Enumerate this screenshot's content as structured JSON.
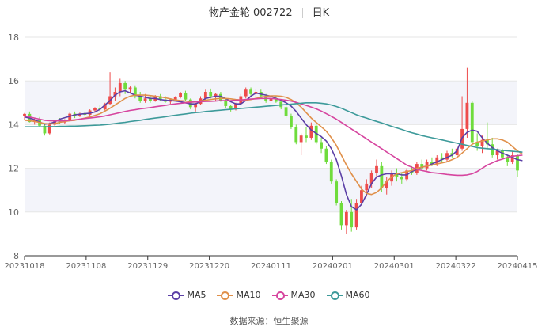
{
  "header": {
    "stock": "物产金轮 002722",
    "period": "日K"
  },
  "source": "数据来源：恒生聚源",
  "colors": {
    "up": "#ee4b4b",
    "down": "#6fdc3c",
    "band": "#f3f4fa",
    "grid": "#e6e6e6",
    "axis": "#666666"
  },
  "chart_data": {
    "type": "candlestick",
    "title": "物产金轮 002722",
    "ylim": [
      8,
      18
    ],
    "yticks": [
      8,
      10,
      12,
      14,
      16,
      18
    ],
    "xtick_labels": [
      "20231018",
      "20231108",
      "20231129",
      "20231220",
      "20240111",
      "20240201",
      "20240301",
      "20240322",
      "20240415"
    ],
    "legend_position": "bottom-center",
    "legend": [
      {
        "name": "MA5",
        "color": "#5b3fa6"
      },
      {
        "name": "MA10",
        "color": "#e0904a"
      },
      {
        "name": "MA30",
        "color": "#d6459f"
      },
      {
        "name": "MA60",
        "color": "#3d9a9a"
      }
    ],
    "ohlc": [
      [
        14.39,
        14.53,
        14.2,
        14.49
      ],
      [
        14.49,
        14.6,
        14.1,
        14.12
      ],
      [
        14.12,
        14.3,
        14.0,
        14.2
      ],
      [
        14.2,
        14.35,
        13.9,
        13.95
      ],
      [
        13.95,
        14.05,
        13.5,
        13.6
      ],
      [
        13.6,
        14.1,
        13.55,
        14.0
      ],
      [
        14.0,
        14.2,
        13.95,
        14.15
      ],
      [
        14.15,
        14.3,
        14.05,
        14.1
      ],
      [
        14.1,
        14.25,
        14.05,
        14.2
      ],
      [
        14.2,
        14.55,
        14.15,
        14.5
      ],
      [
        14.5,
        14.6,
        14.3,
        14.4
      ],
      [
        14.4,
        14.55,
        14.35,
        14.5
      ],
      [
        14.5,
        14.6,
        14.4,
        14.45
      ],
      [
        14.45,
        14.7,
        14.4,
        14.65
      ],
      [
        14.65,
        14.8,
        14.55,
        14.75
      ],
      [
        14.75,
        14.9,
        14.6,
        14.7
      ],
      [
        14.7,
        15.0,
        14.65,
        14.95
      ],
      [
        14.95,
        16.4,
        14.9,
        15.3
      ],
      [
        15.3,
        15.7,
        15.1,
        15.5
      ],
      [
        15.5,
        16.1,
        15.3,
        15.9
      ],
      [
        15.9,
        16.0,
        15.4,
        15.6
      ],
      [
        15.6,
        15.75,
        15.45,
        15.7
      ],
      [
        15.7,
        15.8,
        15.2,
        15.3
      ],
      [
        15.3,
        15.5,
        15.0,
        15.1
      ],
      [
        15.1,
        15.4,
        15.0,
        15.2
      ],
      [
        15.2,
        15.3,
        15.0,
        15.1
      ],
      [
        15.1,
        15.35,
        15.05,
        15.3
      ],
      [
        15.3,
        15.4,
        15.1,
        15.15
      ],
      [
        15.15,
        15.3,
        15.0,
        15.05
      ],
      [
        15.05,
        15.2,
        14.95,
        15.15
      ],
      [
        15.15,
        15.3,
        15.1,
        15.25
      ],
      [
        15.25,
        15.5,
        15.2,
        15.45
      ],
      [
        15.45,
        15.55,
        15.1,
        15.15
      ],
      [
        15.15,
        15.2,
        14.7,
        14.8
      ],
      [
        14.8,
        15.0,
        14.6,
        14.95
      ],
      [
        14.95,
        15.3,
        14.9,
        15.2
      ],
      [
        15.2,
        15.6,
        15.1,
        15.5
      ],
      [
        15.5,
        15.65,
        15.2,
        15.3
      ],
      [
        15.3,
        15.45,
        15.1,
        15.4
      ],
      [
        15.4,
        15.5,
        15.05,
        15.1
      ],
      [
        15.1,
        15.2,
        14.75,
        14.85
      ],
      [
        14.85,
        14.9,
        14.6,
        14.7
      ],
      [
        14.7,
        15.0,
        14.65,
        14.95
      ],
      [
        14.95,
        15.4,
        14.9,
        15.3
      ],
      [
        15.3,
        15.7,
        15.2,
        15.6
      ],
      [
        15.6,
        15.7,
        15.3,
        15.4
      ],
      [
        15.4,
        15.6,
        15.2,
        15.5
      ],
      [
        15.5,
        15.6,
        15.2,
        15.3
      ],
      [
        15.3,
        15.4,
        15.0,
        15.1
      ],
      [
        15.1,
        15.25,
        14.9,
        15.2
      ],
      [
        15.2,
        15.3,
        15.0,
        15.05
      ],
      [
        15.05,
        15.15,
        14.7,
        14.8
      ],
      [
        14.8,
        14.9,
        14.3,
        14.4
      ],
      [
        14.4,
        14.5,
        13.8,
        13.9
      ],
      [
        13.9,
        14.0,
        13.1,
        13.2
      ],
      [
        13.2,
        13.6,
        12.6,
        13.5
      ],
      [
        13.5,
        13.9,
        13.2,
        13.4
      ],
      [
        13.4,
        14.1,
        13.3,
        13.95
      ],
      [
        13.95,
        14.0,
        13.1,
        13.2
      ],
      [
        13.2,
        13.4,
        12.7,
        12.9
      ],
      [
        12.9,
        13.0,
        12.2,
        12.3
      ],
      [
        12.3,
        12.4,
        11.3,
        11.4
      ],
      [
        11.4,
        11.5,
        10.3,
        10.4
      ],
      [
        10.4,
        10.5,
        9.2,
        9.4
      ],
      [
        9.4,
        10.1,
        9.0,
        10.0
      ],
      [
        10.0,
        10.6,
        9.1,
        9.3
      ],
      [
        9.3,
        10.6,
        9.2,
        10.4
      ],
      [
        10.4,
        11.2,
        10.3,
        11.0
      ],
      [
        11.0,
        11.5,
        10.7,
        11.3
      ],
      [
        11.3,
        11.9,
        11.1,
        11.8
      ],
      [
        11.8,
        12.4,
        11.6,
        12.1
      ],
      [
        12.1,
        12.3,
        10.9,
        11.1
      ],
      [
        11.1,
        11.6,
        10.8,
        11.4
      ],
      [
        11.4,
        11.9,
        11.2,
        11.8
      ],
      [
        11.8,
        12.0,
        11.4,
        11.6
      ],
      [
        11.6,
        11.8,
        11.3,
        11.5
      ],
      [
        11.5,
        12.0,
        11.4,
        11.9
      ],
      [
        11.9,
        12.1,
        11.7,
        11.8
      ],
      [
        11.8,
        12.3,
        11.7,
        12.2
      ],
      [
        12.2,
        12.4,
        11.9,
        12.0
      ],
      [
        12.0,
        12.4,
        11.9,
        12.3
      ],
      [
        12.3,
        12.5,
        12.1,
        12.2
      ],
      [
        12.2,
        12.6,
        12.1,
        12.5
      ],
      [
        12.5,
        12.7,
        12.3,
        12.4
      ],
      [
        12.4,
        12.8,
        12.3,
        12.7
      ],
      [
        12.7,
        12.9,
        12.5,
        12.6
      ],
      [
        12.6,
        13.0,
        12.5,
        12.9
      ],
      [
        12.9,
        15.3,
        12.8,
        13.8
      ],
      [
        13.8,
        16.6,
        13.4,
        15.0
      ],
      [
        15.0,
        15.1,
        13.0,
        13.2
      ],
      [
        13.2,
        13.6,
        12.8,
        13.0
      ],
      [
        13.0,
        13.5,
        12.7,
        13.3
      ],
      [
        13.3,
        14.1,
        12.9,
        13.1
      ],
      [
        13.1,
        13.4,
        12.5,
        12.6
      ],
      [
        12.6,
        12.9,
        12.4,
        12.8
      ],
      [
        12.8,
        12.9,
        12.4,
        12.5
      ],
      [
        12.5,
        12.6,
        12.1,
        12.3
      ],
      [
        12.3,
        12.8,
        12.2,
        12.6
      ],
      [
        12.6,
        12.65,
        11.6,
        11.9
      ]
    ],
    "ma5": [
      14.35,
      14.3,
      14.22,
      14.12,
      14.02,
      14.05,
      14.12,
      14.25,
      14.32,
      14.38,
      14.45,
      14.48,
      14.5,
      14.52,
      14.58,
      14.7,
      14.9,
      15.1,
      15.35,
      15.5,
      15.55,
      15.45,
      15.35,
      15.3,
      15.25,
      15.2,
      15.2,
      15.15,
      15.12,
      15.1,
      15.08,
      15.05,
      15.0,
      14.95,
      14.95,
      15.05,
      15.2,
      15.25,
      15.3,
      15.3,
      15.2,
      15.05,
      14.95,
      14.95,
      15.1,
      15.3,
      15.45,
      15.4,
      15.35,
      15.3,
      15.2,
      15.12,
      15.0,
      14.85,
      14.6,
      14.3,
      14.0,
      13.75,
      13.6,
      13.45,
      13.25,
      12.9,
      12.4,
      11.65,
      10.8,
      10.25,
      10.1,
      10.35,
      10.8,
      11.3,
      11.6,
      11.7,
      11.75,
      11.75,
      11.75,
      11.7,
      11.7,
      11.85,
      11.95,
      12.05,
      12.1,
      12.2,
      12.3,
      12.4,
      12.5,
      12.6,
      12.8,
      13.4,
      13.65,
      13.75,
      13.7,
      13.4,
      13.15,
      12.95,
      12.8,
      12.7,
      12.6,
      12.5,
      12.4,
      12.35
    ],
    "ma10": [
      14.2,
      14.18,
      14.15,
      14.1,
      14.05,
      14.03,
      14.05,
      14.1,
      14.15,
      14.18,
      14.2,
      14.25,
      14.3,
      14.35,
      14.42,
      14.5,
      14.62,
      14.75,
      14.9,
      15.05,
      15.2,
      15.3,
      15.35,
      15.35,
      15.35,
      15.33,
      15.3,
      15.27,
      15.23,
      15.18,
      15.13,
      15.1,
      15.08,
      15.05,
      15.05,
      15.08,
      15.12,
      15.15,
      15.18,
      15.2,
      15.2,
      15.18,
      15.15,
      15.13,
      15.12,
      15.15,
      15.2,
      15.25,
      15.3,
      15.32,
      15.32,
      15.3,
      15.25,
      15.15,
      15.0,
      14.8,
      14.55,
      14.3,
      14.1,
      13.9,
      13.7,
      13.4,
      13.05,
      12.6,
      12.15,
      11.75,
      11.4,
      11.05,
      10.85,
      10.8,
      10.9,
      11.1,
      11.4,
      11.6,
      11.75,
      11.8,
      11.85,
      11.9,
      12.0,
      12.05,
      12.1,
      12.15,
      12.2,
      12.25,
      12.3,
      12.4,
      12.5,
      12.7,
      12.9,
      13.1,
      13.2,
      13.25,
      13.3,
      13.35,
      13.35,
      13.3,
      13.2,
      13.0,
      12.8,
      12.65
    ],
    "ma30": [
      14.4,
      14.35,
      14.3,
      14.25,
      14.2,
      14.18,
      14.17,
      14.17,
      14.18,
      14.2,
      14.22,
      14.25,
      14.28,
      14.3,
      14.33,
      14.36,
      14.4,
      14.45,
      14.5,
      14.55,
      14.6,
      14.65,
      14.68,
      14.72,
      14.75,
      14.78,
      14.82,
      14.85,
      14.88,
      14.92,
      14.95,
      14.98,
      15.0,
      15.02,
      15.04,
      15.05,
      15.06,
      15.07,
      15.08,
      15.1,
      15.1,
      15.1,
      15.12,
      15.13,
      15.15,
      15.17,
      15.18,
      15.2,
      15.2,
      15.2,
      15.18,
      15.15,
      15.12,
      15.08,
      15.02,
      14.95,
      14.88,
      14.8,
      14.72,
      14.62,
      14.5,
      14.38,
      14.25,
      14.1,
      13.95,
      13.8,
      13.65,
      13.5,
      13.35,
      13.2,
      13.05,
      12.9,
      12.75,
      12.6,
      12.45,
      12.3,
      12.15,
      12.05,
      11.95,
      11.9,
      11.85,
      11.8,
      11.78,
      11.75,
      11.72,
      11.7,
      11.68,
      11.68,
      11.7,
      11.75,
      11.85,
      12.0,
      12.15,
      12.25,
      12.35,
      12.42,
      12.5,
      12.55,
      12.58,
      12.6
    ],
    "ma60": [
      13.9,
      13.9,
      13.9,
      13.9,
      13.9,
      13.91,
      13.91,
      13.92,
      13.92,
      13.93,
      13.93,
      13.94,
      13.95,
      13.96,
      13.97,
      13.98,
      14.0,
      14.02,
      14.05,
      14.08,
      14.1,
      14.14,
      14.17,
      14.2,
      14.24,
      14.27,
      14.3,
      14.33,
      14.36,
      14.4,
      14.43,
      14.46,
      14.49,
      14.52,
      14.55,
      14.57,
      14.6,
      14.62,
      14.64,
      14.66,
      14.68,
      14.7,
      14.72,
      14.74,
      14.76,
      14.78,
      14.8,
      14.82,
      14.84,
      14.86,
      14.88,
      14.9,
      14.92,
      14.94,
      14.96,
      14.98,
      15.0,
      15.0,
      15.0,
      14.98,
      14.95,
      14.9,
      14.83,
      14.75,
      14.65,
      14.55,
      14.45,
      14.37,
      14.3,
      14.22,
      14.15,
      14.08,
      14.0,
      13.92,
      13.85,
      13.78,
      13.7,
      13.63,
      13.57,
      13.5,
      13.45,
      13.4,
      13.35,
      13.3,
      13.25,
      13.2,
      13.15,
      13.1,
      13.05,
      13.0,
      12.95,
      12.92,
      12.9,
      12.88,
      12.85,
      12.82,
      12.8,
      12.78,
      12.76,
      12.74
    ]
  }
}
